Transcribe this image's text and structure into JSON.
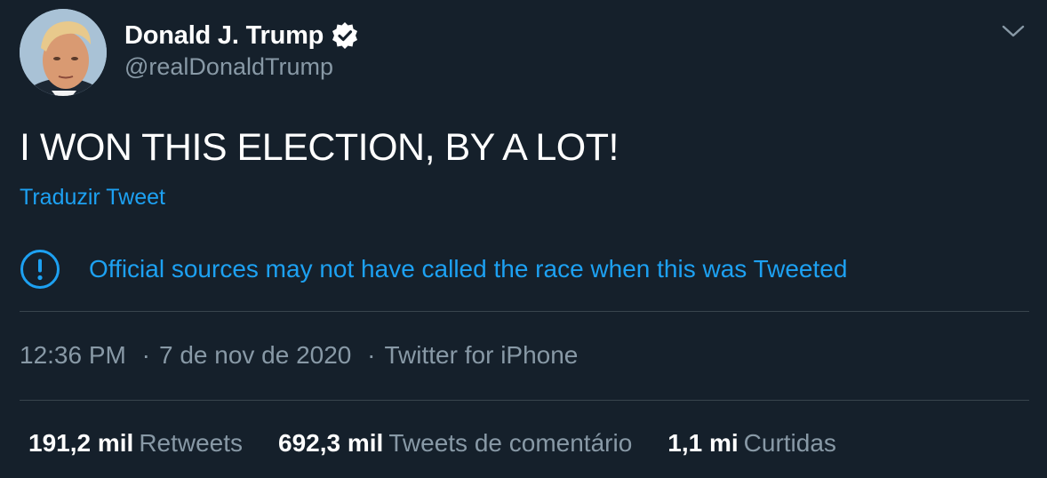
{
  "user": {
    "display_name": "Donald J. Trump",
    "handle": "@realDonaldTrump",
    "verified": true
  },
  "tweet": {
    "text": "I WON THIS ELECTION, BY A LOT!",
    "translate_label": "Traduzir Tweet",
    "notice": "Official sources may not have called the race when this was Tweeted"
  },
  "meta": {
    "time": "12:36 PM",
    "date": "7 de nov de 2020",
    "source": "Twitter for iPhone",
    "separator": "·"
  },
  "stats": [
    {
      "value": "191,2 mil",
      "label": "Retweets"
    },
    {
      "value": "692,3 mil",
      "label": "Tweets de comentário"
    },
    {
      "value": "1,1 mi",
      "label": "Curtidas"
    }
  ],
  "colors": {
    "background": "#15202b",
    "accent": "#1da1f2",
    "secondary_text": "#8899a6",
    "divider": "#38444d"
  },
  "icons": {
    "verified": "verified-badge-icon",
    "caret": "chevron-down-icon",
    "notice": "exclamation-circle-icon"
  }
}
